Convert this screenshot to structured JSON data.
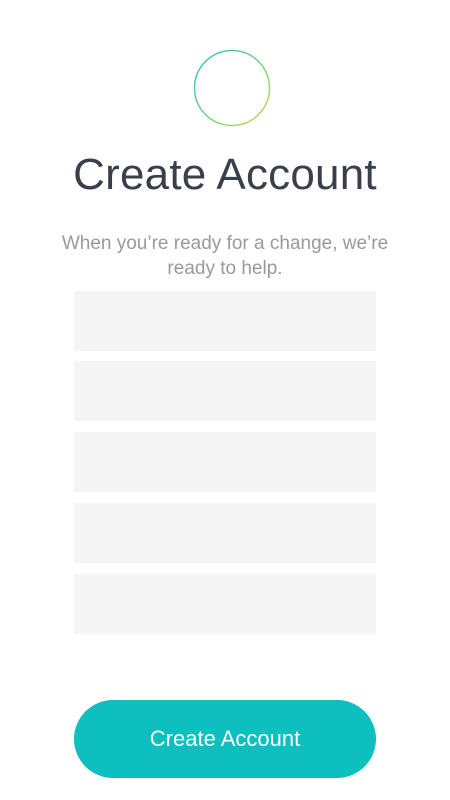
{
  "header": {
    "logo_icon": "plus-circle-icon",
    "title": "Create Account",
    "subtitle": "When you’re ready for a change, we’re ready to help."
  },
  "form": {
    "fields": [
      {
        "value": "",
        "placeholder": ""
      },
      {
        "value": "",
        "placeholder": ""
      },
      {
        "value": "",
        "placeholder": ""
      },
      {
        "value": "",
        "placeholder": ""
      },
      {
        "value": "",
        "placeholder": ""
      }
    ],
    "submit_label": "Create Account"
  },
  "colors": {
    "accent": "#0dbfbf",
    "gradient_start": "#2cc5c0",
    "gradient_end": "#c6d84a",
    "title_text": "#3a3f4b",
    "muted_text": "#9a9a9a",
    "field_bg": "#f5f5f5"
  }
}
